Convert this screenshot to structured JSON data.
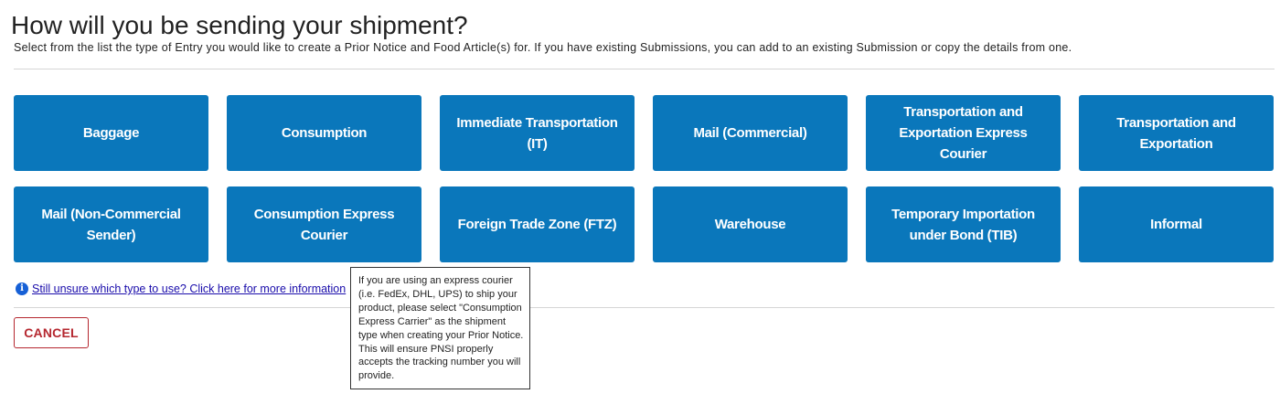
{
  "page": {
    "title": "How will you be sending your shipment?",
    "subtitle": "Select from the list the type of Entry you would like to create a Prior Notice and Food Article(s) for. If you have existing Submissions, you can add to an existing Submission or copy the details from one."
  },
  "shipment_types": [
    {
      "label": "Baggage"
    },
    {
      "label": "Consumption"
    },
    {
      "label": "Immediate Transportation (IT)"
    },
    {
      "label": "Mail (Commercial)"
    },
    {
      "label": "Transportation and Exportation Express Courier"
    },
    {
      "label": "Transportation and Exportation"
    },
    {
      "label": "Mail (Non-Commercial Sender)"
    },
    {
      "label": "Consumption Express Courier"
    },
    {
      "label": "Foreign Trade Zone (FTZ)"
    },
    {
      "label": "Warehouse"
    },
    {
      "label": "Temporary Importation under Bond (TIB)"
    },
    {
      "label": "Informal"
    }
  ],
  "help": {
    "icon": "info-icon",
    "icon_glyph": "i",
    "link_text": "Still unsure which type to use? Click here for more information"
  },
  "tooltip": {
    "text": "If you are using an express courier (i.e. FedEx, DHL, UPS) to ship your product, please select \"Consumption Express Carrier\" as the shipment type when creating your Prior Notice. This will ensure PNSI properly accepts the tracking number you will provide."
  },
  "actions": {
    "cancel_label": "CANCEL"
  },
  "colors": {
    "button_blue": "#0a77bb",
    "cancel_red": "#b5272f",
    "info_blue": "#1660d6",
    "link_color": "#1a0dab"
  }
}
